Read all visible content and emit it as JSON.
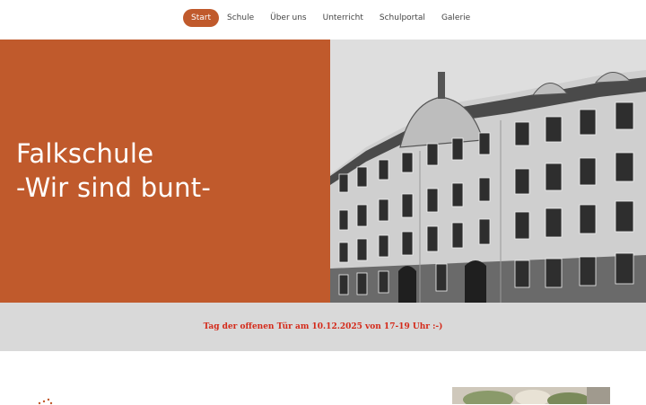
{
  "nav": {
    "items": [
      {
        "label": "Start",
        "active": true
      },
      {
        "label": "Schule",
        "active": false
      },
      {
        "label": "Über uns",
        "active": false
      },
      {
        "label": "Unterricht",
        "active": false
      },
      {
        "label": "Schulportal",
        "active": false
      },
      {
        "label": "Galerie",
        "active": false
      }
    ]
  },
  "hero": {
    "title_line1": "Falkschule",
    "title_line2": "-Wir sind bunt-",
    "image": "school-building-photo"
  },
  "banner": {
    "text": "Tag der offenen Tür am 10.12.2025 von 17-19 Uhr :-)"
  },
  "colors": {
    "accent": "#c05a2c",
    "banner_bg": "#d9d9d9",
    "banner_text": "#d42a1a"
  }
}
